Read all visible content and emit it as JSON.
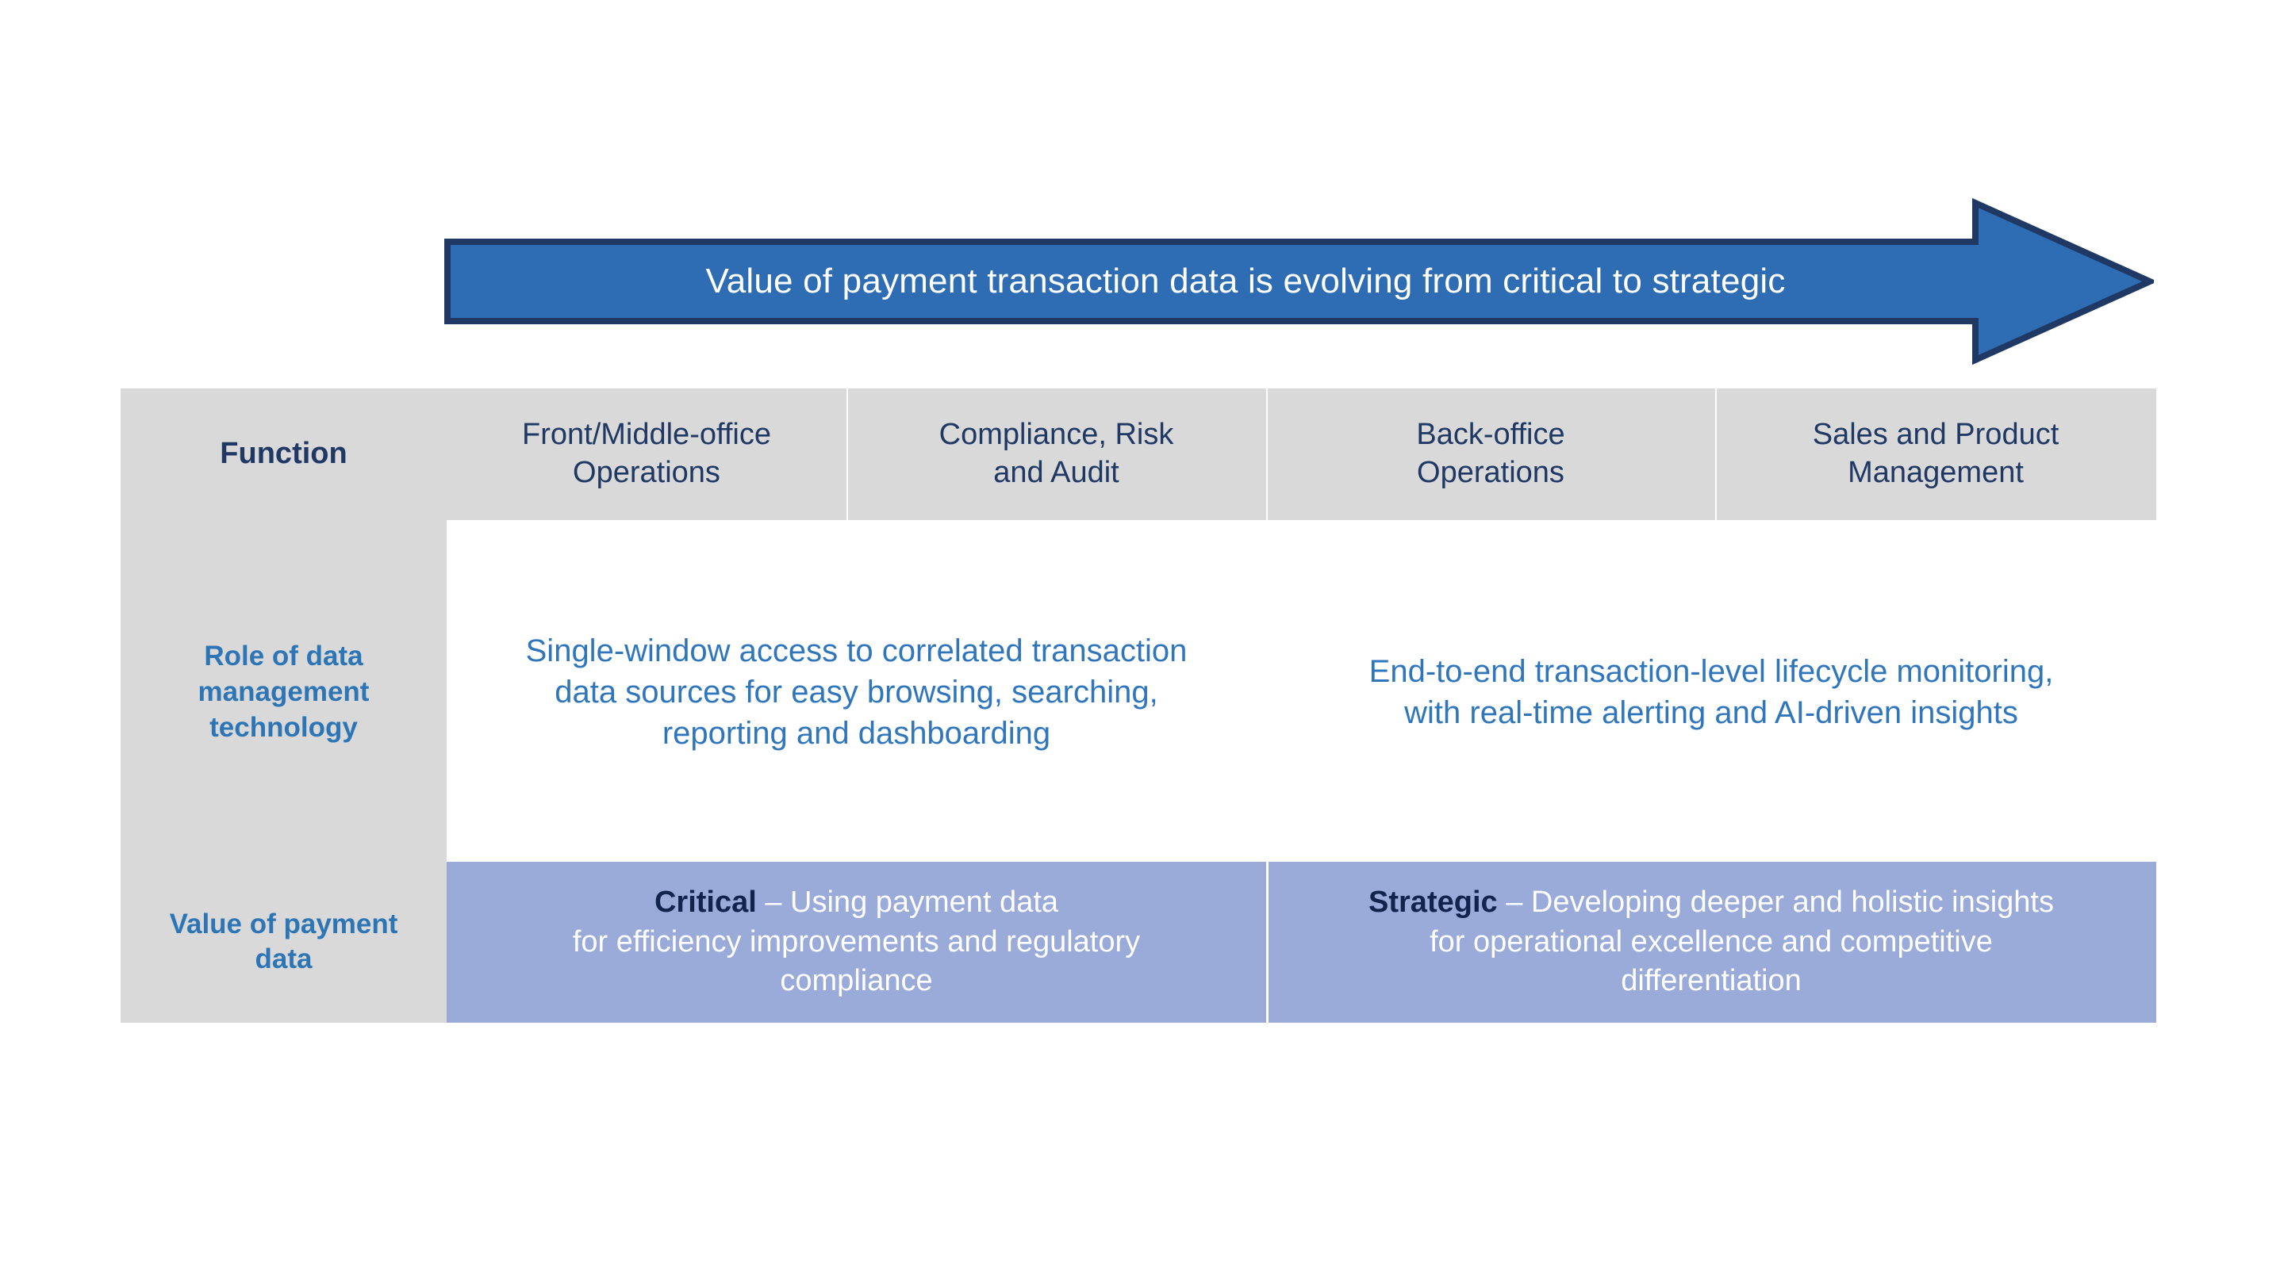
{
  "banner": {
    "text": "Value of payment transaction data is evolving from critical to strategic",
    "fill_color": "#2E6DB4",
    "outline_color": "#1F3864",
    "text_color": "#FFFFFF"
  },
  "colors": {
    "header_fill": "#D9D9D9",
    "label_fill": "#D9D9D9",
    "value_row_fill": "#9AABDA",
    "rule": "#1F3864",
    "heading_text": "#1F3864",
    "row_label_text": "#2E75B6",
    "body_text_blue": "#2F76BD",
    "body_text_white": "#FFFFFF",
    "emphasis_dark": "#10244D"
  },
  "table": {
    "headers": [
      "Function",
      "Front/Middle-office Operations",
      "Compliance, Risk and Audit",
      "Back-office Operations",
      "Sales and Product Management"
    ],
    "header_lines": {
      "col0": [
        "Function"
      ],
      "col1": [
        "Front/Middle-office",
        "Operations"
      ],
      "col2": [
        "Compliance, Risk",
        "and Audit"
      ],
      "col3": [
        "Back-office",
        "Operations"
      ],
      "col4": [
        "Sales and Product",
        "Management"
      ]
    },
    "rows": [
      {
        "id": "role-of-data-management-technology",
        "label": "Role of data management technology",
        "label_lines": [
          "Role of data",
          "management",
          "technology"
        ],
        "cells": [
          {
            "id": "role-left",
            "span": 2,
            "text": "Single-window access to correlated transaction data sources for easy browsing, searching, reporting and dashboarding",
            "lines": [
              "Single-window access to correlated transaction",
              "data sources for easy browsing, searching,",
              "reporting and dashboarding"
            ]
          },
          {
            "id": "role-right",
            "span": 2,
            "text": "End-to-end transaction-level lifecycle monitoring, with real-time alerting and AI-driven insights",
            "lines": [
              "End-to-end transaction-level lifecycle monitoring,",
              "with real-time alerting and AI-driven insights"
            ]
          }
        ]
      },
      {
        "id": "value-of-payment-data",
        "label": "Value of payment data",
        "label_lines": [
          "Value of payment",
          "data"
        ],
        "cells": [
          {
            "id": "value-critical",
            "span": 2,
            "emphasis": "Critical",
            "text": "Critical – Using payment data for efficiency improvements and regulatory compliance",
            "lines": [
              " – Using payment data",
              "for efficiency improvements and regulatory",
              "compliance"
            ]
          },
          {
            "id": "value-strategic",
            "span": 2,
            "emphasis": "Strategic",
            "text": "Strategic – Developing deeper and holistic insights for operational excellence and competitive differentiation",
            "lines": [
              " – Developing deeper and holistic insights",
              "for operational excellence and competitive",
              "differentiation"
            ]
          }
        ]
      }
    ]
  }
}
